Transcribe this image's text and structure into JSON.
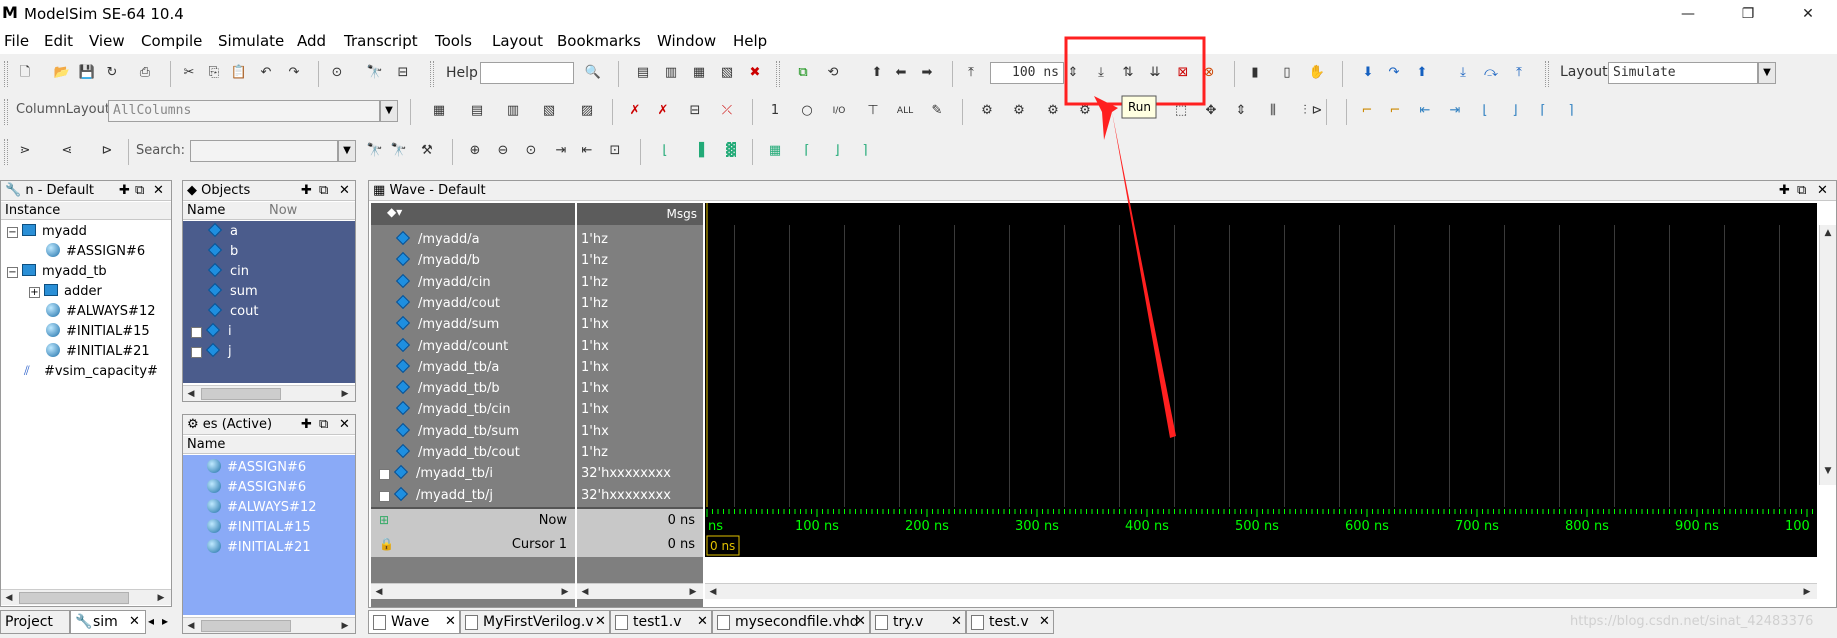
{
  "window": {
    "app_icon": "M",
    "title": "ModelSim SE-64 10.4",
    "minimize": "—",
    "restore": "❐",
    "close": "✕"
  },
  "menu": [
    "File",
    "Edit",
    "View",
    "Compile",
    "Simulate",
    "Add",
    "Transcript",
    "Tools",
    "Layout",
    "Bookmarks",
    "Window",
    "Help"
  ],
  "toolbar": {
    "help_label": "Help",
    "help_value": "",
    "run_length": "100 ns",
    "run_tooltip": "Run",
    "layout_label": "Layout",
    "layout_value": "Simulate",
    "column_layout_label": "ColumnLayout",
    "column_layout_value": "AllColumns",
    "search_label": "Search:",
    "search_value": ""
  },
  "sim_panel": {
    "title": "n - Default",
    "col_instance": "Instance",
    "items": [
      {
        "label": "myadd",
        "indent": 0,
        "icon": "block-icon",
        "expander": "−"
      },
      {
        "label": "#ASSIGN#6",
        "indent": 1,
        "icon": "process-icon",
        "expander": ""
      },
      {
        "label": "myadd_tb",
        "indent": 0,
        "icon": "block-icon",
        "expander": "−"
      },
      {
        "label": "adder",
        "indent": 1,
        "icon": "block-icon",
        "expander": "+"
      },
      {
        "label": "#ALWAYS#12",
        "indent": 1,
        "icon": "process-icon",
        "expander": ""
      },
      {
        "label": "#INITIAL#15",
        "indent": 1,
        "icon": "process-icon",
        "expander": ""
      },
      {
        "label": "#INITIAL#21",
        "indent": 1,
        "icon": "process-icon",
        "expander": ""
      },
      {
        "label": "#vsim_capacity#",
        "indent": 0,
        "icon": "capacity-icon",
        "expander": ""
      }
    ]
  },
  "objects_panel": {
    "title": "Objects",
    "col_name": "Name",
    "col_now": "Now",
    "items": [
      {
        "label": "a",
        "expander": ""
      },
      {
        "label": "b",
        "expander": ""
      },
      {
        "label": "cin",
        "expander": ""
      },
      {
        "label": "sum",
        "expander": ""
      },
      {
        "label": "cout",
        "expander": ""
      },
      {
        "label": "i",
        "expander": "+"
      },
      {
        "label": "j",
        "expander": "+"
      }
    ]
  },
  "processes_panel": {
    "title": "es (Active)",
    "col_name": "Name",
    "items": [
      "#ASSIGN#6",
      "#ASSIGN#6",
      "#ALWAYS#12",
      "#INITIAL#15",
      "#INITIAL#21"
    ]
  },
  "wave_panel": {
    "title": "Wave - Default",
    "msgs_label": "Msgs",
    "signals": [
      {
        "name": "/myadd/a",
        "value": "1'hz",
        "expander": ""
      },
      {
        "name": "/myadd/b",
        "value": "1'hz",
        "expander": ""
      },
      {
        "name": "/myadd/cin",
        "value": "1'hz",
        "expander": ""
      },
      {
        "name": "/myadd/cout",
        "value": "1'hz",
        "expander": ""
      },
      {
        "name": "/myadd/sum",
        "value": "1'hx",
        "expander": ""
      },
      {
        "name": "/myadd/count",
        "value": "1'hx",
        "expander": ""
      },
      {
        "name": "/myadd_tb/a",
        "value": "1'hx",
        "expander": ""
      },
      {
        "name": "/myadd_tb/b",
        "value": "1'hx",
        "expander": ""
      },
      {
        "name": "/myadd_tb/cin",
        "value": "1'hx",
        "expander": ""
      },
      {
        "name": "/myadd_tb/sum",
        "value": "1'hx",
        "expander": ""
      },
      {
        "name": "/myadd_tb/cout",
        "value": "1'hz",
        "expander": ""
      },
      {
        "name": "/myadd_tb/i",
        "value": "32'hxxxxxxxx",
        "expander": "+"
      },
      {
        "name": "/myadd_tb/j",
        "value": "32'hxxxxxxxx",
        "expander": "+"
      }
    ],
    "now_label": "Now",
    "now_value": "0 ns",
    "cursor_label": "Cursor 1",
    "cursor_value": "0 ns",
    "cursor_marker": "0 ns",
    "timeline_ticks": [
      "ns",
      "100 ns",
      "200 ns",
      "300 ns",
      "400 ns",
      "500 ns",
      "600 ns",
      "700 ns",
      "800 ns",
      "900 ns",
      "100"
    ]
  },
  "bottom_tabs_left": [
    {
      "label": "Project",
      "active": false
    },
    {
      "label": "sim",
      "active": true
    }
  ],
  "bottom_tabs_wave": [
    {
      "label": "Wave",
      "active": true
    },
    {
      "label": "MyFirstVerilog.v",
      "active": false
    },
    {
      "label": "test1.v",
      "active": false
    },
    {
      "label": "mysecondfile.vhd",
      "active": false
    },
    {
      "label": "try.v",
      "active": false
    },
    {
      "label": "test.v",
      "active": false
    }
  ],
  "watermark": "https://blog.csdn.net/sinat_42483376",
  "colors": {
    "wave_bg": "#000000",
    "grid": "#3a3a3a",
    "timeline_green": "#00ff00",
    "cursor_yellow": "#e0c000",
    "signal_panel_bg": "#7f7f7f",
    "objects_bg": "#4b5c8c",
    "processes_bg": "#8aaaf7",
    "annotation_red": "#ff2020"
  }
}
